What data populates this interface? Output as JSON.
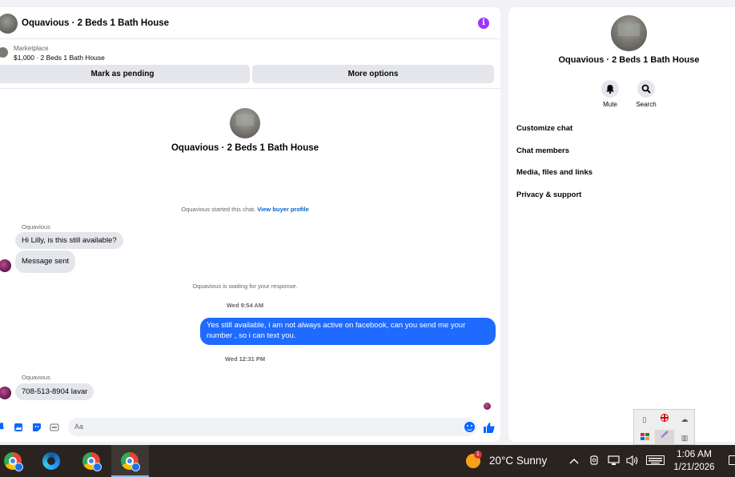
{
  "chat": {
    "title": "Oquavious · 2 Beds 1 Bath House",
    "info_icon_glyph": "i",
    "marketplace_label": "Marketplace",
    "listing": "$1,000 · 2 Beds 1 Bath House",
    "mark_pending_label": "Mark as pending",
    "more_options_label": "More options",
    "center_title": "Oquavious · 2 Beds 1 Bath House",
    "started_text": "Oquavious started this chat.",
    "view_buyer_profile": "View buyer profile",
    "messages": [
      {
        "sender": "Oquavious",
        "text": "Hi Lilly, is this still available?"
      },
      {
        "text": "Message sent"
      },
      {
        "system": "Oquavious is waiting for your response."
      },
      {
        "timestamp": "Wed 9:54 AM"
      },
      {
        "text": "Yes still available, i am not always active on facebook, can you send me your number , so i can text you."
      },
      {
        "timestamp": "Wed 12:31 PM"
      },
      {
        "sender": "Oquavious",
        "text": "708-513-8904  lavar"
      }
    ],
    "composer_placeholder": "Aa"
  },
  "info": {
    "title": "Oquavious · 2 Beds 1 Bath House",
    "mute_label": "Mute",
    "search_label": "Search",
    "menu": [
      "Customize chat",
      "Chat members",
      "Media, files and links",
      "Privacy & support"
    ]
  },
  "taskbar": {
    "weather_badge": "1",
    "weather": "20°C  Sunny",
    "time": "1:06 AM",
    "date": "1/21/2026"
  },
  "colors": {
    "accent": "#0866ff",
    "outgoing_bubble": "#1f6bff",
    "info_icon": "#a033ff",
    "taskbar": "#2a231f"
  }
}
